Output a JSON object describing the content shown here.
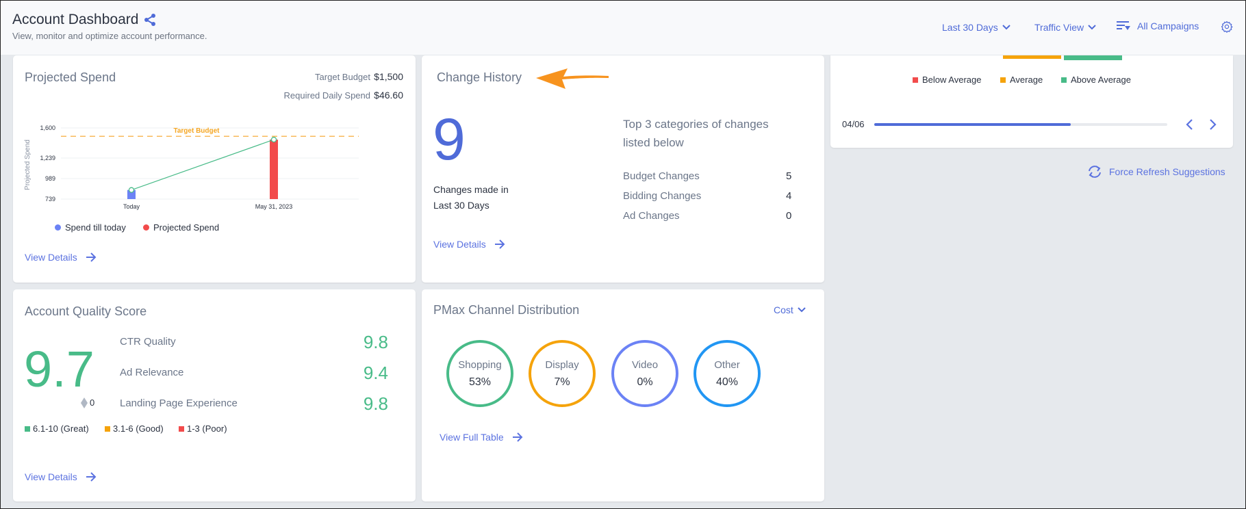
{
  "header": {
    "title": "Account Dashboard",
    "subtitle": "View, monitor and optimize account performance.",
    "date_range": "Last 30 Days",
    "view": "Traffic View",
    "campaign_filter": "All Campaigns"
  },
  "projected_spend": {
    "title": "Projected Spend",
    "target_budget_label": "Target Budget",
    "target_budget_value": "$1,500",
    "required_daily_label": "Required Daily Spend",
    "required_daily_value": "$46.60",
    "view_details": "View Details"
  },
  "chart_data": {
    "type": "bar",
    "title": "Projected Spend",
    "ylabel": "Projected Spend",
    "xlabel": "",
    "categories": [
      "Today",
      "May 31, 2023"
    ],
    "series": [
      {
        "name": "Spend till today",
        "values": [
          850,
          null
        ],
        "color": "#6b82f5"
      },
      {
        "name": "Projected Spend",
        "values": [
          null,
          1460
        ],
        "color": "#f24b4b"
      }
    ],
    "trend_line": {
      "points": [
        850,
        1460
      ],
      "color": "#48bb88"
    },
    "reference_line": {
      "label": "Target Budget",
      "value": 1500,
      "color": "#f5a623"
    },
    "yticks": [
      739,
      989,
      1239,
      1600
    ],
    "ytick_labels": [
      "739",
      "989",
      "1,239",
      "1,600"
    ],
    "ylim": [
      739,
      1600
    ],
    "grid": true,
    "legend": [
      "Spend till today",
      "Projected Spend"
    ],
    "legend_position": "bottom-left"
  },
  "change_history": {
    "title": "Change History",
    "count": "9",
    "caption_line1": "Changes made in",
    "caption_line2": "Last 30 Days",
    "top_heading_line1": "Top 3 categories of changes",
    "top_heading_line2": "listed below",
    "categories": [
      {
        "label": "Budget Changes",
        "value": "5"
      },
      {
        "label": "Bidding Changes",
        "value": "4"
      },
      {
        "label": "Ad Changes",
        "value": "0"
      }
    ],
    "view_details": "View Details"
  },
  "benchmark": {
    "legend": [
      {
        "label": "Below Average",
        "color": "#f24b4b"
      },
      {
        "label": "Average",
        "color": "#f5a30b"
      },
      {
        "label": "Above Average",
        "color": "#48bb88"
      }
    ],
    "pager_label": "04/06",
    "progress": 0.67,
    "force_refresh": "Force Refresh Suggestions"
  },
  "quality_score": {
    "title": "Account Quality Score",
    "score": "9.7",
    "change": "0",
    "metrics": [
      {
        "label": "CTR Quality",
        "value": "9.8"
      },
      {
        "label": "Ad Relevance",
        "value": "9.4"
      },
      {
        "label": "Landing Page Experience",
        "value": "9.8"
      }
    ],
    "legend": [
      {
        "label": "6.1-10 (Great)",
        "color": "#48bb88"
      },
      {
        "label": "3.1-6 (Good)",
        "color": "#f5a30b"
      },
      {
        "label": "1-3 (Poor)",
        "color": "#f24b4b"
      }
    ],
    "view_details": "View Details"
  },
  "pmax": {
    "title": "PMax Channel Distribution",
    "metric": "Cost",
    "channels": [
      {
        "label": "Shopping",
        "value": "53%",
        "color": "#48bb88"
      },
      {
        "label": "Display",
        "value": "7%",
        "color": "#f5a30b"
      },
      {
        "label": "Video",
        "value": "0%",
        "color": "#6b82f5"
      },
      {
        "label": "Other",
        "value": "40%",
        "color": "#2196f3"
      }
    ],
    "view_full_table": "View Full Table"
  }
}
